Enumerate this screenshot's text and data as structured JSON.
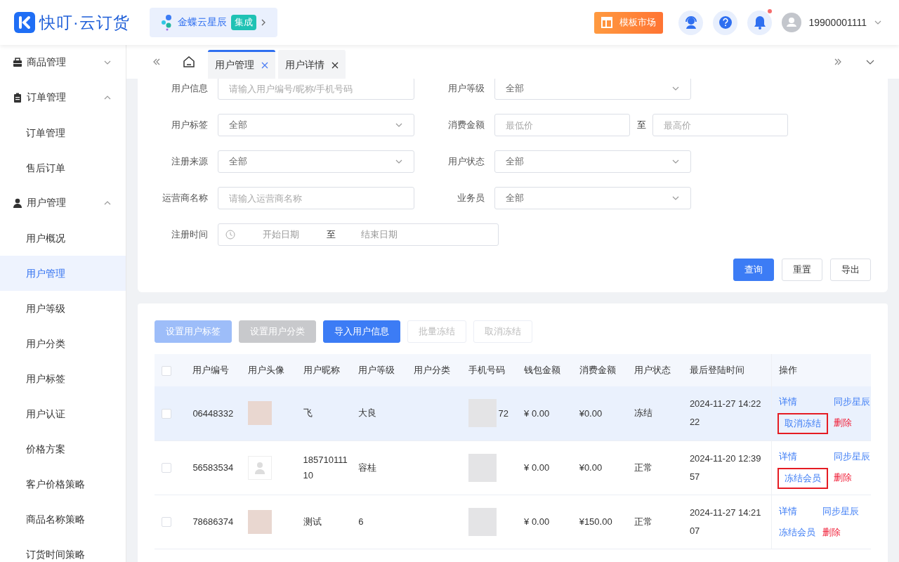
{
  "header": {
    "logo": "快叮·云订货",
    "integration": {
      "name": "金蝶云星辰",
      "badge": "集成"
    },
    "market_button": "模板市场",
    "notification_dot": true,
    "user": "19900001111"
  },
  "sidebar": {
    "groups": [
      {
        "label": "商品管理",
        "expanded": false
      },
      {
        "label": "订单管理",
        "expanded": true,
        "items": [
          {
            "label": "订单管理",
            "selected": false
          },
          {
            "label": "售后订单",
            "selected": false
          }
        ]
      },
      {
        "label": "用户管理",
        "expanded": true,
        "items": [
          {
            "label": "用户概况",
            "selected": false
          },
          {
            "label": "用户管理",
            "selected": true
          },
          {
            "label": "用户等级",
            "selected": false
          },
          {
            "label": "用户分类",
            "selected": false
          },
          {
            "label": "用户标签",
            "selected": false
          },
          {
            "label": "用户认证",
            "selected": false
          },
          {
            "label": "价格方案",
            "selected": false
          },
          {
            "label": "客户价格策略",
            "selected": false
          },
          {
            "label": "商品名称策略",
            "selected": false
          },
          {
            "label": "订货时间策略",
            "selected": false
          }
        ]
      }
    ]
  },
  "tabs": [
    {
      "label": "用户管理",
      "selected": true
    },
    {
      "label": "用户详情",
      "selected": false
    }
  ],
  "filters": [
    {
      "kind": "input",
      "label": "用户信息",
      "placeholder": "请输入用户编号/昵称/手机号码"
    },
    {
      "kind": "select",
      "label": "用户等级",
      "value": "全部"
    },
    {
      "kind": "select",
      "label": "用户标签",
      "value": "全部"
    },
    {
      "kind": "range",
      "label": "消费金额",
      "fields": [
        {
          "placeholder": "最低价"
        },
        {
          "placeholder": "最高价"
        }
      ],
      "separator": "至"
    },
    {
      "kind": "select",
      "label": "注册来源",
      "value": "全部"
    },
    {
      "kind": "select",
      "label": "用户状态",
      "value": "全部"
    },
    {
      "kind": "input",
      "label": "运营商名称",
      "placeholder": "请输入运营商名称"
    },
    {
      "kind": "select",
      "label": "业务员",
      "value": "全部"
    },
    {
      "kind": "date",
      "label": "注册时间",
      "from": "开始日期",
      "separator": "至",
      "to": "结束日期"
    }
  ],
  "filter_buttons": [
    {
      "label": "查询",
      "kind": "primary"
    },
    {
      "label": "重置",
      "kind": "plain"
    },
    {
      "label": "导出",
      "kind": "plain"
    }
  ],
  "toolbar": [
    {
      "label": "设置用户标签",
      "kind": "primary",
      "disabled": true
    },
    {
      "label": "设置用户分类",
      "kind": "gray",
      "disabled": true
    },
    {
      "label": "导入用户信息",
      "kind": "primary",
      "disabled": false
    },
    {
      "label": "批量冻结",
      "kind": "plain",
      "disabled": true
    },
    {
      "label": "取消冻结",
      "kind": "plain",
      "disabled": true
    }
  ],
  "table": {
    "select_all_checked": false,
    "columns": [
      "用户编号",
      "用户头像",
      "用户昵称",
      "用户等级",
      "用户分类",
      "手机号码",
      "钱包金额",
      "消费金额",
      "用户状态",
      "最后登陆时间",
      "操作"
    ],
    "rows": [
      {
        "checked": false,
        "selected": true,
        "id": "06448332",
        "kind": "photo",
        "nickname": "飞",
        "level": "大良",
        "category": "",
        "phone": "72",
        "wallet": "¥ 0.00",
        "spent": "¥0.00",
        "status": "冻结",
        "login": [
          "2024-11-27 14:22",
          "22"
        ],
        "actions": [
          {
            "label": "详情",
            "kind": "link",
            "highlighted": false
          },
          {
            "label": "同步星辰",
            "kind": "link",
            "highlighted": false
          },
          {
            "label": "取消冻结",
            "kind": "link",
            "highlighted": true
          },
          {
            "label": "删除",
            "kind": "danger",
            "highlighted": false
          }
        ]
      },
      {
        "checked": false,
        "selected": false,
        "id": "56583534",
        "kind": "default",
        "nickname": "18571011110",
        "level": "容桂",
        "category": "",
        "phone": "",
        "wallet": "¥ 0.00",
        "spent": "¥0.00",
        "status": "正常",
        "login": [
          "2024-11-20 12:39",
          "57"
        ],
        "actions": [
          {
            "label": "详情",
            "kind": "link",
            "highlighted": false
          },
          {
            "label": "同步星辰",
            "kind": "link",
            "highlighted": false
          },
          {
            "label": "冻结会员",
            "kind": "link",
            "highlighted": true
          },
          {
            "label": "删除",
            "kind": "danger",
            "highlighted": false
          }
        ]
      },
      {
        "checked": false,
        "selected": false,
        "id": "78686374",
        "kind": "photo",
        "nickname": "测试",
        "level": "6",
        "category": "",
        "phone": "",
        "wallet": "¥ 0.00",
        "spent": "¥150.00",
        "status": "正常",
        "login": [
          "2024-11-27 14:21",
          "07"
        ],
        "actions": [
          {
            "label": "详情",
            "kind": "link",
            "highlighted": false
          },
          {
            "label": "同步星辰",
            "kind": "link",
            "highlighted": false
          },
          {
            "label": "冻结会员",
            "kind": "link",
            "highlighted": false
          },
          {
            "label": "删除",
            "kind": "danger",
            "highlighted": false
          }
        ]
      }
    ]
  }
}
